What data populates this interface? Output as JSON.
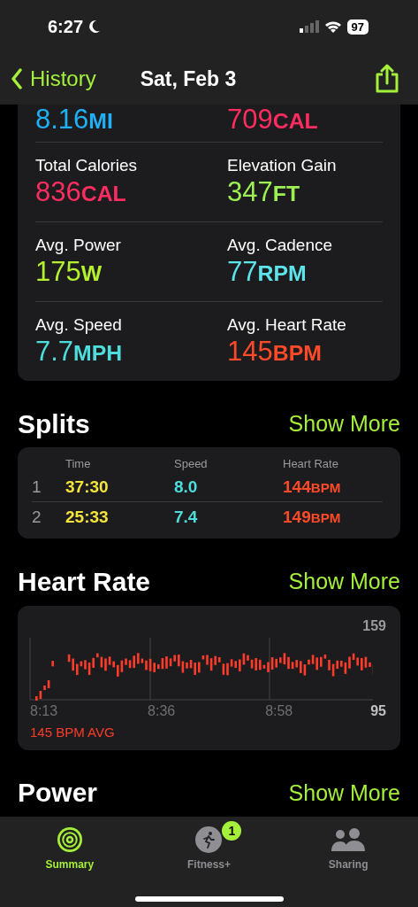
{
  "status_bar": {
    "time": "6:27",
    "battery": "97"
  },
  "nav": {
    "back": "History",
    "title": "Sat, Feb 3"
  },
  "metrics": [
    {
      "value": "8.16",
      "unit": "MI",
      "color": "#1fb0f5"
    },
    {
      "value": "709",
      "unit": "CAL",
      "color": "#ff2d5f"
    },
    {
      "label": "Total Calories",
      "value": "836",
      "unit": "CAL",
      "color": "#ff2d5f"
    },
    {
      "label": "Elevation Gain",
      "value": "347",
      "unit": "FT",
      "color": "#9ef052"
    },
    {
      "label": "Avg. Power",
      "value": "175",
      "unit": "W",
      "color": "#b4f02e"
    },
    {
      "label": "Avg. Cadence",
      "value": "77",
      "unit": "RPM",
      "color": "#5ce4ea"
    },
    {
      "label": "Avg. Speed",
      "value": "7.7",
      "unit": "MPH",
      "color": "#4fdcdc"
    },
    {
      "label": "Avg. Heart Rate",
      "value": "145",
      "unit": "BPM",
      "color": "#ff4a2a"
    }
  ],
  "splits": {
    "title": "Splits",
    "more": "Show More",
    "columns": [
      "Time",
      "Speed",
      "Heart Rate"
    ],
    "rows": [
      {
        "index": "1",
        "time": "37:30",
        "speed": "8.0",
        "heart_rate": "144",
        "unit": "BPM"
      },
      {
        "index": "2",
        "time": "25:33",
        "speed": "7.4",
        "heart_rate": "149",
        "unit": "BPM"
      }
    ]
  },
  "heart_rate": {
    "title": "Heart Rate",
    "more": "Show More",
    "max": "159",
    "min": "95",
    "times": [
      "8:13",
      "8:36",
      "8:58"
    ],
    "average": "145 BPM AVG"
  },
  "power": {
    "title": "Power",
    "more": "Show More"
  },
  "tabs": [
    {
      "label": "Summary",
      "selected": true
    },
    {
      "label": "Fitness+",
      "selected": false,
      "badge": "1"
    },
    {
      "label": "Sharing",
      "selected": false
    }
  ]
}
